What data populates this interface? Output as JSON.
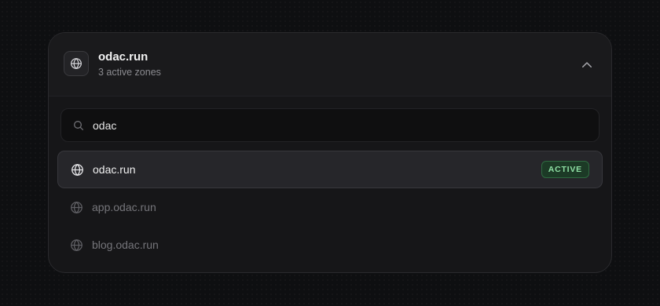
{
  "zone": {
    "title": "odac.run",
    "subtitle": "3 active zones",
    "icon": "globe-icon"
  },
  "search": {
    "value": "odac",
    "icon": "search-icon"
  },
  "results": [
    {
      "label": "odac.run",
      "badge": "ACTIVE",
      "selected": true
    },
    {
      "label": "app.odac.run",
      "selected": false
    },
    {
      "label": "blog.odac.run",
      "selected": false
    }
  ],
  "colors": {
    "badge_text": "#8fe0a4",
    "badge_bg": "#1c3a26",
    "card_bg": "#161618"
  }
}
